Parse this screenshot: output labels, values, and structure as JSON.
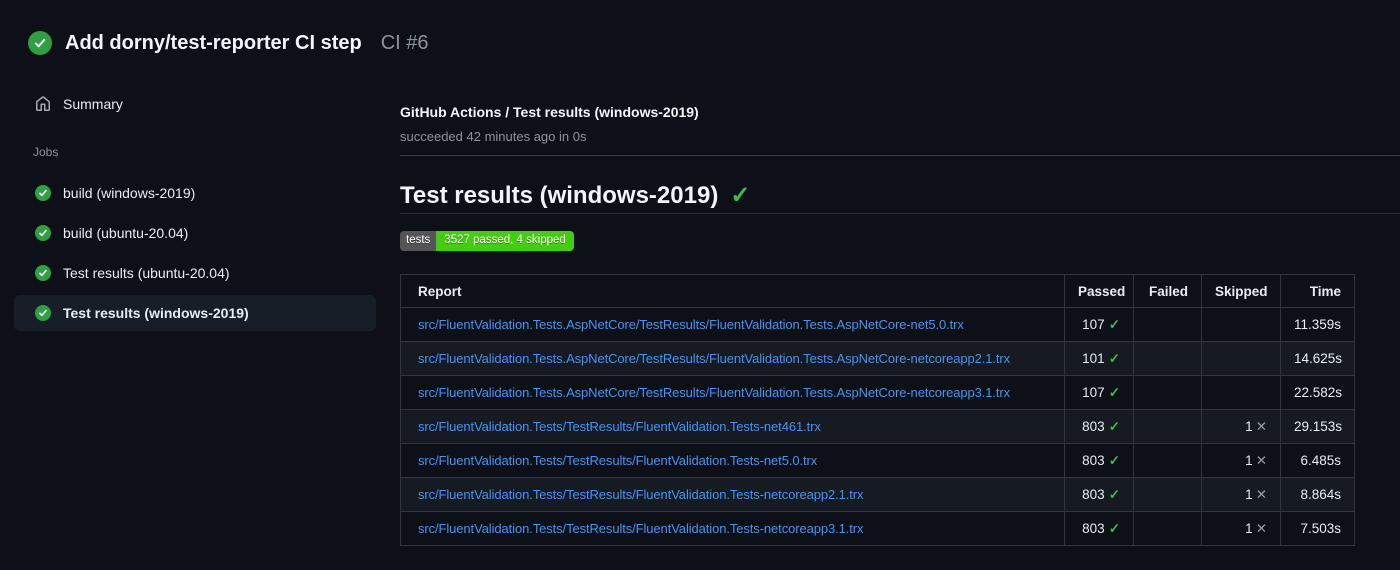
{
  "colors": {
    "bg": "#0d1117",
    "fg": "#e6edf3",
    "fg-bright": "#f0f6fc",
    "muted": "#8b949e",
    "link": "#4493f8",
    "success": "#3fb950",
    "success-circle": "#2ea043",
    "selected-bg": "#181e27",
    "divider": "#333b45",
    "divider-faint": "#262d35",
    "table-border": "#30363d",
    "row-alt": "#161b22",
    "badge-label-bg": "#555555",
    "badge-value-bg": "#44cc11",
    "cross": "#959da5"
  },
  "icons": {
    "check_glyph": "✓",
    "cross_glyph": "✕"
  },
  "header": {
    "title": "Add dorny/test-reporter CI step",
    "run_label": "CI #6"
  },
  "sidebar": {
    "summary_label": "Summary",
    "jobs_section_label": "Jobs",
    "jobs": [
      {
        "label": "build (windows-2019)",
        "selected": false
      },
      {
        "label": "build (ubuntu-20.04)",
        "selected": false
      },
      {
        "label": "Test results (ubuntu-20.04)",
        "selected": false
      },
      {
        "label": "Test results (windows-2019)",
        "selected": true
      }
    ]
  },
  "main": {
    "check_title": "GitHub Actions / Test results (windows-2019)",
    "check_status": "succeeded 42 minutes ago in 0s",
    "heading": "Test results (windows-2019)",
    "badge": {
      "label": "tests",
      "value": "3527 passed, 4 skipped"
    },
    "table": {
      "columns": [
        "Report",
        "Passed",
        "Failed",
        "Skipped",
        "Time"
      ],
      "rows": [
        {
          "report": "src/FluentValidation.Tests.AspNetCore/TestResults/FluentValidation.Tests.AspNetCore-net5.0.trx",
          "passed": "107",
          "failed": "",
          "skipped": "",
          "time": "11.359s"
        },
        {
          "report": "src/FluentValidation.Tests.AspNetCore/TestResults/FluentValidation.Tests.AspNetCore-netcoreapp2.1.trx",
          "passed": "101",
          "failed": "",
          "skipped": "",
          "time": "14.625s"
        },
        {
          "report": "src/FluentValidation.Tests.AspNetCore/TestResults/FluentValidation.Tests.AspNetCore-netcoreapp3.1.trx",
          "passed": "107",
          "failed": "",
          "skipped": "",
          "time": "22.582s"
        },
        {
          "report": "src/FluentValidation.Tests/TestResults/FluentValidation.Tests-net461.trx",
          "passed": "803",
          "failed": "",
          "skipped": "1",
          "time": "29.153s"
        },
        {
          "report": "src/FluentValidation.Tests/TestResults/FluentValidation.Tests-net5.0.trx",
          "passed": "803",
          "failed": "",
          "skipped": "1",
          "time": "6.485s"
        },
        {
          "report": "src/FluentValidation.Tests/TestResults/FluentValidation.Tests-netcoreapp2.1.trx",
          "passed": "803",
          "failed": "",
          "skipped": "1",
          "time": "8.864s"
        },
        {
          "report": "src/FluentValidation.Tests/TestResults/FluentValidation.Tests-netcoreapp3.1.trx",
          "passed": "803",
          "failed": "",
          "skipped": "1",
          "time": "7.503s"
        }
      ]
    }
  }
}
